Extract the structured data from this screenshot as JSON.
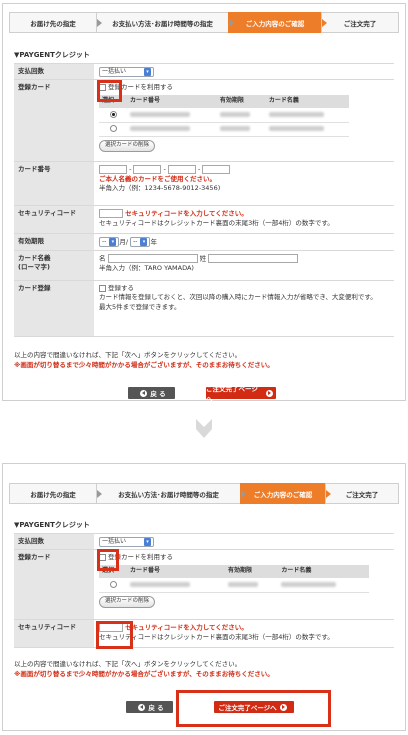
{
  "steps": [
    "お届け先の指定",
    "お支払い方法･お届け時間等の指定",
    "ご入力内容のご確認",
    "ご注文完了"
  ],
  "section_title": "▼PAYGENTクレジット",
  "labels": {
    "payment_count": "支払回数",
    "registered_card": "登録カード",
    "card_number": "カード番号",
    "security_code": "セキュリティコード",
    "expiry": "有効期限",
    "card_name": "カード名義\n(ローマ字)",
    "card_register": "カード登録"
  },
  "payment_count_value": "一括払い",
  "use_registered_label": "登録カードを利用する",
  "table_headers": [
    "選択",
    "カード番号",
    "有効期限",
    "カード名義"
  ],
  "delete_button": "選択カードの削除",
  "card_number_warning": "ご本人名義のカードをご使用ください。",
  "card_number_hint": "半角入力（例：1234-5678-9012-3456)",
  "security_warning": "セキュリティコードを入力してください。",
  "security_hint": "セキュリティコードはクレジットカード裏面の末尾3桁（一部4桁）の数字です。",
  "expiry_month": "--",
  "expiry_month_unit": "月/",
  "expiry_year": "--",
  "expiry_year_unit": "年",
  "name_first_label": "名",
  "name_last_label": "姓",
  "name_hint": "半角入力（例：TARO YAMADA)",
  "register_check_label": "登録する",
  "register_desc": "カード情報を登録しておくと、次回以降の購入時にカード情報入力が省略でき、大変便利です。",
  "register_limit": "最大5件まで登録できます。",
  "confirm_text": "以上の内容で間違いなければ、下記「次へ」ボタンをクリックしてください。",
  "confirm_warning": "※画面が切り替るまで少々時間がかかる場合がございますが、そのままお待ちください。",
  "back_button": "戻 る",
  "next_button": "ご注文完了ページへ",
  "colors": {
    "accent": "#ee7d2a",
    "warning": "#d12b14",
    "highlight": "#d9301a"
  },
  "icons": {
    "step_arrow": "chevron-right-icon",
    "down_arrow": "down-arrow-icon",
    "back": "back-arrow-icon",
    "next": "next-arrow-icon"
  }
}
